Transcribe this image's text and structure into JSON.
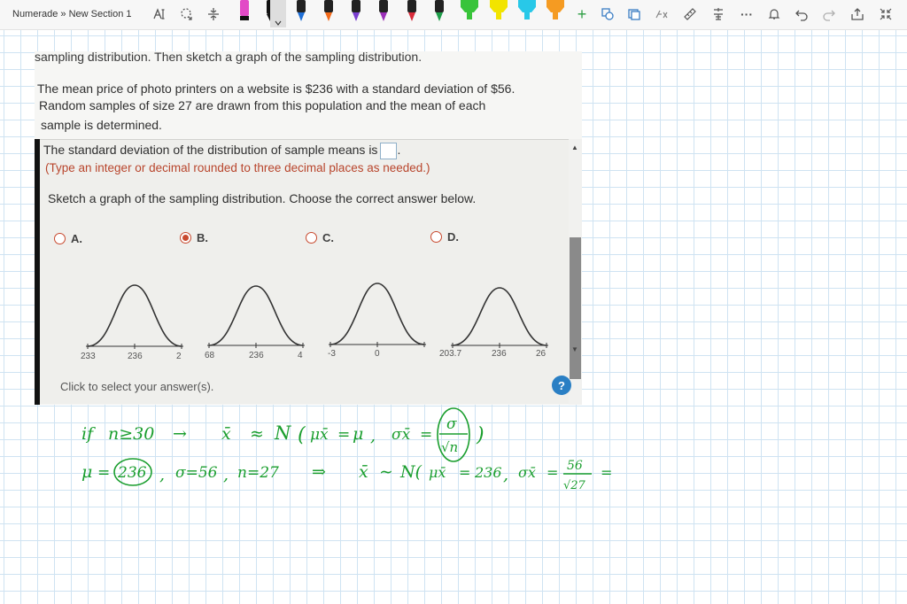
{
  "app": {
    "breadcrumb": "Numerade » New Section 1"
  },
  "toolbar": {
    "accent_bg": "#dedede",
    "icons": [
      "text-select-icon",
      "lasso-icon",
      "insert-space-icon",
      "pen-icon",
      "plus-icon",
      "shape-icon",
      "image-icon",
      "math-icon",
      "ruler-icon",
      "translate-icon",
      "more-icon",
      "notification-icon",
      "undo-icon",
      "redo-icon",
      "share-icon",
      "collapse-icon"
    ],
    "pens": [
      {
        "color": "#e24ac6",
        "name": "pink-pen"
      },
      {
        "color": "#111111",
        "name": "black-pen"
      },
      {
        "color": "#111111",
        "name": "black-pen-selected",
        "selected": true
      },
      {
        "color": "#1f6fd6",
        "name": "blue-pen"
      },
      {
        "color": "#f36a1a",
        "name": "orange-pen"
      },
      {
        "color": "#7a3fd0",
        "name": "purple-pen"
      },
      {
        "color": "#9b2fb8",
        "name": "violet-pen"
      },
      {
        "color": "#d92b3a",
        "name": "red-pen"
      },
      {
        "color": "#1e9e4a",
        "name": "green-pen"
      },
      {
        "color": "#38c43a",
        "name": "green-highlighter"
      },
      {
        "color": "#f2e400",
        "name": "yellow-highlighter"
      },
      {
        "color": "#28c8e8",
        "name": "cyan-highlighter"
      },
      {
        "color": "#f59b22",
        "name": "orange-highlighter"
      }
    ]
  },
  "question": {
    "header": "sampling distribution. Then sketch a graph of the sampling distribution.",
    "body_line1": "The mean price of photo printers on a website is $236 with a standard deviation of $56.",
    "body_line2": "Random samples of size 27 are drawn from this population and the mean of each",
    "body_line3": "sample is determined.",
    "sd_prompt": "The standard deviation of the distribution of sample means is",
    "sd_prompt_end": ".",
    "sd_hint": "(Type an integer or decimal rounded to three decimal places as needed.)",
    "sketch_prompt": "Sketch a graph of the sampling distribution. Choose the correct answer below.",
    "options": [
      {
        "label": "A.",
        "checked": false,
        "ticks": [
          "233",
          "236",
          "2"
        ]
      },
      {
        "label": "B.",
        "checked": true,
        "ticks": [
          "68",
          "236",
          "4"
        ]
      },
      {
        "label": "C.",
        "checked": false,
        "ticks": [
          "-3",
          "0",
          ""
        ]
      },
      {
        "label": "D.",
        "checked": false,
        "ticks": [
          "203.7",
          "236",
          "26"
        ]
      }
    ],
    "footer": "Click to select your answer(s).",
    "help": "?"
  },
  "handwriting": {
    "color": "#1a9e2e",
    "line1": [
      "if",
      "n≥30",
      "→",
      "x̄",
      "≈",
      "N",
      "(",
      "μx̄",
      "=",
      "μ",
      ",",
      "σx̄",
      "=",
      "σ",
      "√n",
      ")"
    ],
    "line2": [
      "μ",
      "=",
      "236",
      ",",
      "σ=56",
      ",",
      "n=27",
      "⇒",
      "x̄",
      "∼",
      "N(",
      "μx̄",
      "=",
      "236",
      ",",
      "σx̄",
      "=",
      "56",
      "√27",
      "="
    ]
  }
}
